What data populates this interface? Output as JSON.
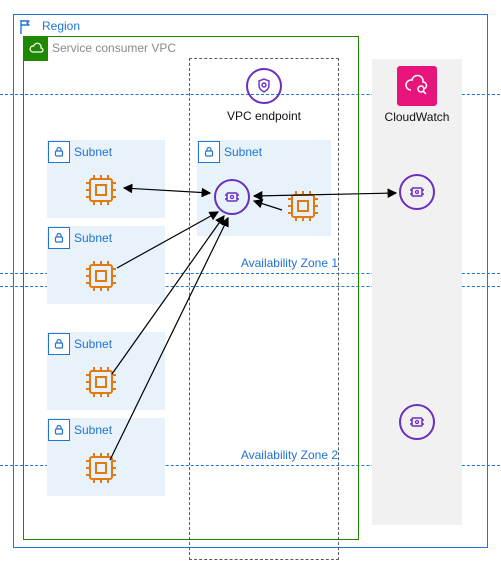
{
  "region": {
    "label": "Region"
  },
  "vpc": {
    "label": "Service consumer VPC"
  },
  "endpoint": {
    "label": "VPC endpoint"
  },
  "availability_zones": [
    {
      "label": "Availability Zone 1"
    },
    {
      "label": "Availability Zone 2"
    }
  ],
  "subnets": {
    "az1_private_1": {
      "label": "Subnet"
    },
    "az1_private_2": {
      "label": "Subnet"
    },
    "az1_public": {
      "label": "Subnet"
    },
    "az2_private_1": {
      "label": "Subnet"
    },
    "az2_private_2": {
      "label": "Subnet"
    }
  },
  "cloudwatch": {
    "label": "CloudWatch"
  },
  "icons": {
    "region_flag": "flag-icon",
    "vpc_cloud": "cloud-icon",
    "endpoint_shield": "shield-icon",
    "lock": "lock-icon",
    "chip": "cpu-chip-icon",
    "eni": "network-interface-icon",
    "cloudwatch": "cloudwatch-icon"
  },
  "colors": {
    "region_border": "#2074d5",
    "vpc_border": "#1e8900",
    "subnet_bg": "#e8f2fb",
    "chip": "#e47911",
    "endpoint": "#6b2fbf",
    "cloudwatch": "#e7157b",
    "az_dash": "#2074d5"
  },
  "connections": [
    {
      "from": "chip-az1-1",
      "to": "eni-az1",
      "bidirectional": true
    },
    {
      "from": "chip-az1-2",
      "to": "eni-az1",
      "bidirectional": false
    },
    {
      "from": "chip-az2-1",
      "to": "eni-az1",
      "bidirectional": false
    },
    {
      "from": "chip-az2-2",
      "to": "eni-az1",
      "bidirectional": false
    },
    {
      "from": "chip-public-az1",
      "to": "eni-az1",
      "bidirectional": false
    },
    {
      "from": "eni-az1",
      "to": "eni-cw-az1",
      "bidirectional": true
    }
  ]
}
